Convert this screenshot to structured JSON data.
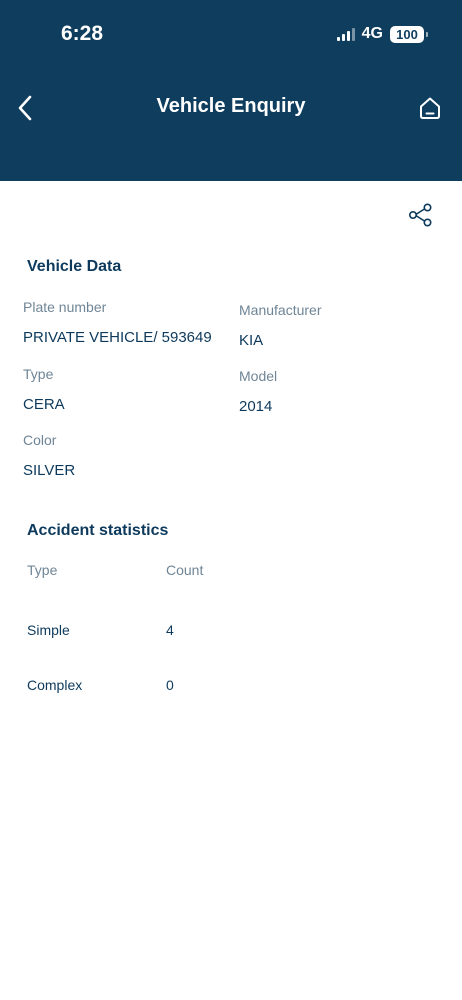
{
  "status_bar": {
    "time": "6:28",
    "network": "4G",
    "battery": "100"
  },
  "header": {
    "title": "Vehicle Enquiry",
    "back_icon": "chevron-left-icon",
    "home_icon": "home-icon"
  },
  "share_icon": "share-icon",
  "vehicle_data": {
    "title": "Vehicle Data",
    "plate_number_label": "Plate number",
    "plate_number_value": "PRIVATE VEHICLE/ 593649",
    "manufacturer_label": "Manufacturer",
    "manufacturer_value": "KIA",
    "type_label": "Type",
    "type_value": "CERA",
    "model_label": "Model",
    "model_value": "2014",
    "color_label": "Color",
    "color_value": "SILVER"
  },
  "accident_statistics": {
    "title": "Accident statistics",
    "columns": [
      "Type",
      "Count"
    ],
    "rows": [
      {
        "type": "Simple",
        "count": "4"
      },
      {
        "type": "Complex",
        "count": "0"
      }
    ]
  },
  "colors": {
    "header_bg": "#0e3d5e",
    "text_primary": "#0d3a5c",
    "text_label": "#6f8596"
  }
}
